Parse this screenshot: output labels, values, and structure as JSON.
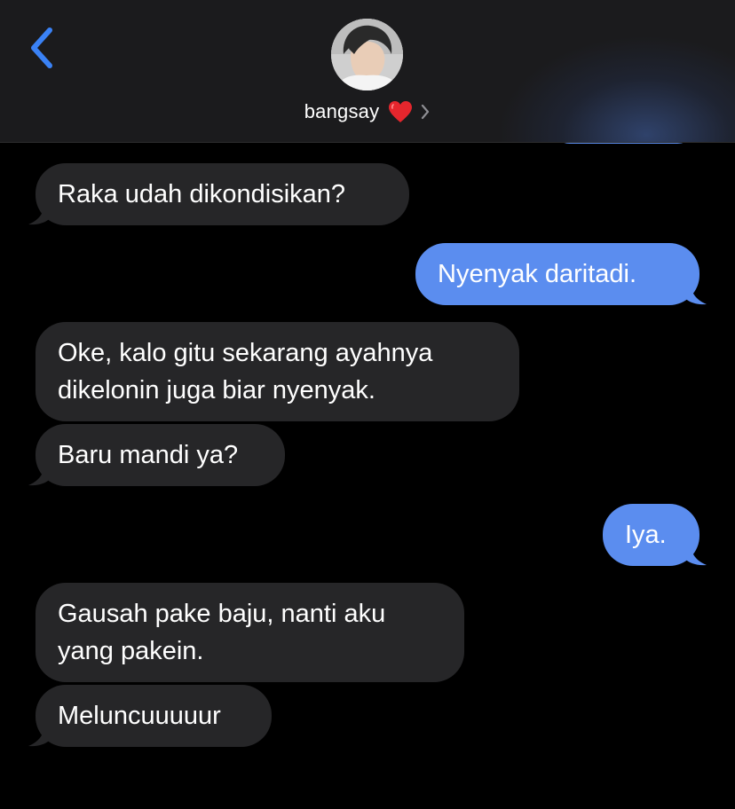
{
  "header": {
    "contact_name": "bangsay",
    "accent_color": "#3a82f6",
    "back_icon": "chevron-left-icon",
    "heart_icon": "red-heart-emoji",
    "disclosure_icon": "chevron-right-icon"
  },
  "colors": {
    "incoming_bubble": "#262628",
    "outgoing_bubble": "#5b8def",
    "background": "#000000",
    "header_background": "#1b1b1d"
  },
  "messages": [
    {
      "direction": "incoming",
      "lines": [
        "Raka udah dikondisikan?"
      ]
    },
    {
      "direction": "outgoing",
      "lines": [
        "Nyenyak daritadi."
      ]
    },
    {
      "direction": "incoming",
      "lines": [
        "Oke, kalo gitu sekarang ayahnya",
        "dikelonin juga biar nyenyak."
      ]
    },
    {
      "direction": "incoming",
      "lines": [
        "Baru mandi ya?"
      ]
    },
    {
      "direction": "outgoing",
      "lines": [
        "Iya."
      ]
    },
    {
      "direction": "incoming",
      "lines": [
        "Gausah pake baju, nanti aku",
        "yang pakein."
      ]
    },
    {
      "direction": "incoming",
      "lines": [
        "Meluncuuuuur"
      ]
    }
  ]
}
